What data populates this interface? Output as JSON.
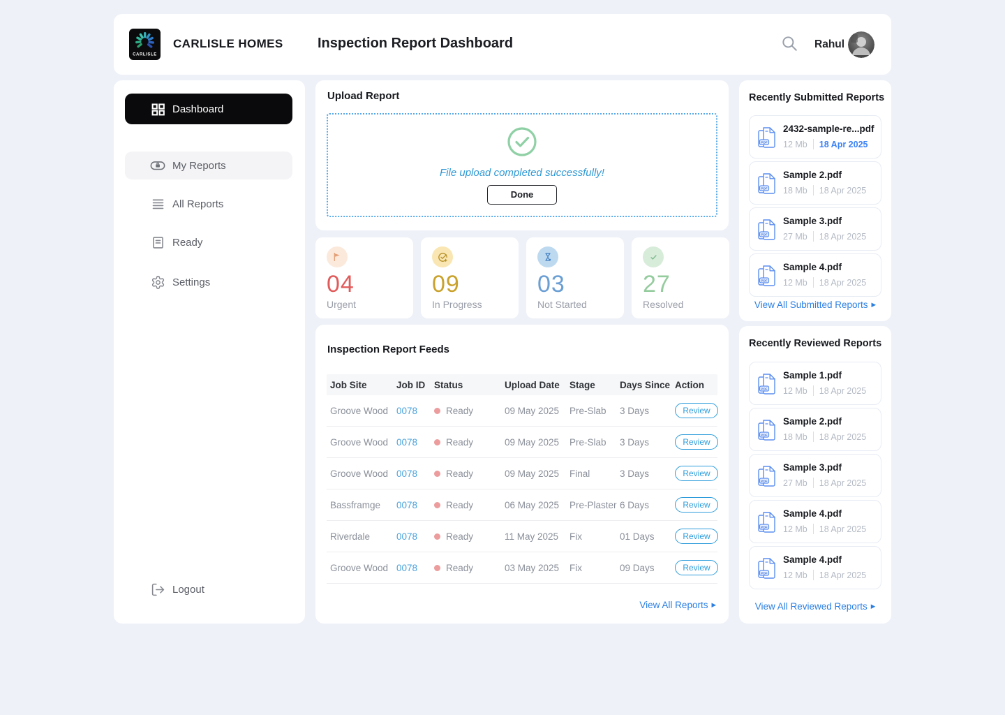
{
  "colors": {
    "page_background": "#eef1f8",
    "accent_blue": "#2d9cdb",
    "link_blue": "#2b7fe3",
    "upload_border_blue": "#55a8e8",
    "success_green": "#8fd0a5",
    "urgent_red": "#e15b5b",
    "in_progress_gold": "#c9a22c",
    "not_started_blue": "#6b9fd4",
    "resolved_green": "#95cc9e",
    "status_dot_pink": "#ec9c9c",
    "date_highlight_blue": "#3b82f6"
  },
  "header": {
    "brand": "CARLISLE HOMES",
    "logo_text": "CARLISLE",
    "title": "Inspection Report Dashboard",
    "user_name": "Rahul",
    "icons": [
      "search-icon",
      "avatar"
    ]
  },
  "sidebar": {
    "items": [
      {
        "label": "Dashboard",
        "icon": "dashboard-grid-icon",
        "active": true
      },
      {
        "label": "My Reports",
        "icon": "briefcase-badge-icon",
        "active": false
      },
      {
        "label": "All Reports",
        "icon": "list-lines-icon",
        "active": false
      },
      {
        "label": "Ready",
        "icon": "document-icon",
        "active": false
      },
      {
        "label": "Settings",
        "icon": "gear-icon",
        "active": false
      }
    ],
    "logout": {
      "label": "Logout",
      "icon": "logout-icon"
    }
  },
  "upload": {
    "title": "Upload Report",
    "success_message": "File upload completed successfully!",
    "success_icon": "check-circle-icon",
    "done_label": "Done"
  },
  "stats": [
    {
      "value": "04",
      "label": "Urgent",
      "icon": "flag-icon",
      "color": "#e15b5b"
    },
    {
      "value": "09",
      "label": "In Progress",
      "icon": "progress-check-icon",
      "color": "#c9a22c"
    },
    {
      "value": "03",
      "label": "Not Started",
      "icon": "hourglass-icon",
      "color": "#6b9fd4"
    },
    {
      "value": "27",
      "label": "Resolved",
      "icon": "check-icon",
      "color": "#95cc9e"
    }
  ],
  "feeds": {
    "title": "Inspection Report Feeds",
    "columns": [
      "Job Site",
      "Job ID",
      "Status",
      "Upload Date",
      "Stage",
      "Days Since",
      "Action"
    ],
    "rows": [
      {
        "job_site": "Groove Wood",
        "job_id": "0078",
        "status": "Ready",
        "upload_date": "09 May 2025",
        "stage": "Pre-Slab",
        "days_since": "3 Days",
        "action": "Review"
      },
      {
        "job_site": "Groove Wood",
        "job_id": "0078",
        "status": "Ready",
        "upload_date": "09 May 2025",
        "stage": "Pre-Slab",
        "days_since": "3 Days",
        "action": "Review"
      },
      {
        "job_site": "Groove Wood",
        "job_id": "0078",
        "status": "Ready",
        "upload_date": "09 May 2025",
        "stage": "Final",
        "days_since": "3 Days",
        "action": "Review"
      },
      {
        "job_site": "Bassframge",
        "job_id": "0078",
        "status": "Ready",
        "upload_date": "06 May 2025",
        "stage": "Pre-Plaster",
        "days_since": "6 Days",
        "action": "Review"
      },
      {
        "job_site": "Riverdale",
        "job_id": "0078",
        "status": "Ready",
        "upload_date": "11 May 2025",
        "stage": "Fix",
        "days_since": "01 Days",
        "action": "Review"
      },
      {
        "job_site": "Groove Wood",
        "job_id": "0078",
        "status": "Ready",
        "upload_date": "03 May 2025",
        "stage": "Fix",
        "days_since": "09 Days",
        "action": "Review"
      }
    ],
    "view_all_label": "View All Reports"
  },
  "submitted": {
    "title": "Recently Submitted Reports",
    "items": [
      {
        "name": "2432-sample-re...pdf",
        "size": "12 Mb",
        "date": "18 Apr 2025",
        "icon": "pdf-file-icon"
      },
      {
        "name": "Sample 2.pdf",
        "size": "18 Mb",
        "date": "18 Apr 2025",
        "icon": "pdf-file-icon"
      },
      {
        "name": "Sample 3.pdf",
        "size": "27 Mb",
        "date": "18 Apr 2025",
        "icon": "pdf-file-icon"
      },
      {
        "name": "Sample 4.pdf",
        "size": "12 Mb",
        "date": "18 Apr 2025",
        "icon": "pdf-file-icon"
      }
    ],
    "view_all_label": "View All Submitted Reports"
  },
  "reviewed": {
    "title": "Recently Reviewed Reports",
    "items": [
      {
        "name": "Sample 1.pdf",
        "size": "12 Mb",
        "date": "18 Apr 2025",
        "icon": "pdf-file-icon"
      },
      {
        "name": "Sample 2.pdf",
        "size": "18 Mb",
        "date": "18 Apr 2025",
        "icon": "pdf-file-icon"
      },
      {
        "name": "Sample 3.pdf",
        "size": "27 Mb",
        "date": "18 Apr 2025",
        "icon": "pdf-file-icon"
      },
      {
        "name": "Sample 4.pdf",
        "size": "12 Mb",
        "date": "18 Apr 2025",
        "icon": "pdf-file-icon"
      },
      {
        "name": "Sample 4.pdf",
        "size": "12 Mb",
        "date": "18 Apr 2025",
        "icon": "pdf-file-icon"
      }
    ],
    "view_all_label": "View All Reviewed Reports"
  }
}
